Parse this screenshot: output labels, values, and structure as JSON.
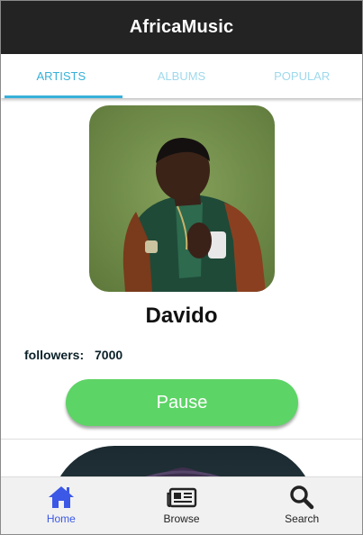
{
  "app": {
    "title": "AfricaMusic"
  },
  "tabs": [
    {
      "label": "ARTISTS",
      "active": true
    },
    {
      "label": "ALBUMS",
      "active": false
    },
    {
      "label": "POPULAR",
      "active": false
    }
  ],
  "artist": {
    "name": "Davido",
    "followers_label": "followers:",
    "followers_count": "7000",
    "play_button_label": "Pause"
  },
  "bottom_nav": [
    {
      "label": "Home",
      "icon": "home-icon",
      "active": true
    },
    {
      "label": "Browse",
      "icon": "newspaper-icon",
      "active": false
    },
    {
      "label": "Search",
      "icon": "search-icon",
      "active": false
    }
  ],
  "colors": {
    "app_bar": "#232323",
    "tab_active": "#37b1d8",
    "tab_inactive": "#9fd9ec",
    "play_button": "#5dd466",
    "nav_active": "#3c58e6"
  }
}
